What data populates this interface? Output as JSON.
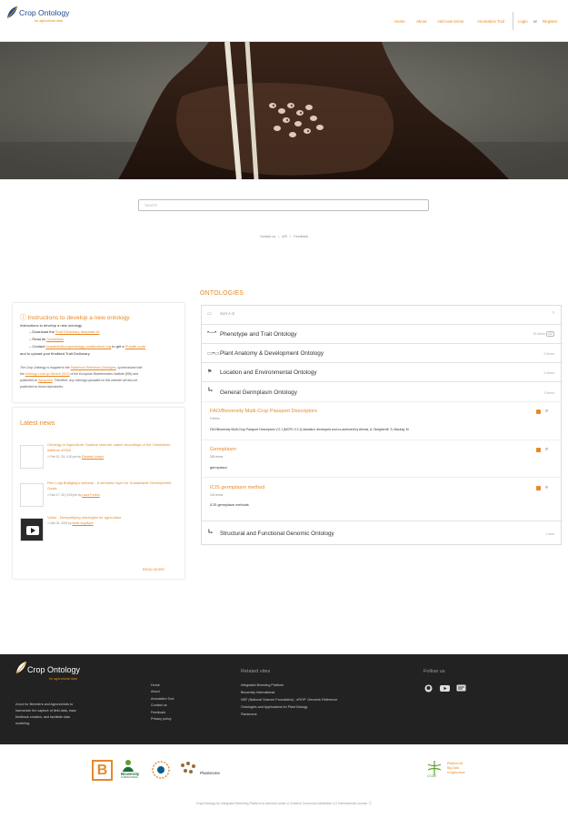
{
  "header": {
    "logo_title": "Crop Ontology",
    "logo_tagline": "for agricultural data",
    "nav": [
      "Home",
      "About",
      "Add new terms",
      "Annotation Tool"
    ],
    "login": "Login",
    "or": "or",
    "register": "Register"
  },
  "search": {
    "placeholder": "Search"
  },
  "links": {
    "contact": "Contact us",
    "sep": "•",
    "api": "API",
    "feedback": "Feedback"
  },
  "instructions": {
    "title": "Instructions to develop a new ontology",
    "intro": "Instructions to develop a new ontology",
    "step1_prefix": "Download the",
    "step1_link": "Trait Dictionary template v5",
    "step2_prefix": "Read its",
    "step2_link": "Guidelines",
    "step3_prefix": "Contact",
    "step3_email": "helpdesk@cropontology-curationtool.org",
    "step3_mid": "to get a",
    "step3_link": "Private code",
    "step3_suffix": "and to upload your finalised Trait Dictionary",
    "note1": "The Crop Ontology is mapped to the",
    "note1_link": "Planteome Reference Ontologies",
    "note1_suffix": ", synchronized with",
    "note2": "the",
    "note2_link": "Ontology Look-up Service (OLS)",
    "note2_suffix": "of the European Bioinformatics Institute (EBI) and",
    "note3": "published on",
    "note3_link": "Agroportal",
    "note3_suffix": ". Therefore, any ontology uploaded on this website will also be",
    "note4": "published on those repositories."
  },
  "news": {
    "title": "Latest news",
    "items": [
      {
        "title": "Ontology in Agriculture Youtube channel: watch recordings of the Ontoinfarm webinar #2020",
        "date": "Feb 10, 20 | 4:00 pm",
        "by": "by",
        "author": "Elizabeth Arnaud"
      },
      {
        "title": "Pier Luigi Buttigieg's webinar - A semantic layer for Sustainable Development Goals",
        "date": "Dec 17, 20 | 4:00 pm",
        "by": "by",
        "author": "Laura Forcina"
      },
      {
        "title": "Video - Demystifying ontologies for agriculture",
        "date": "Mar 23, 2019",
        "by": "by",
        "author": "Marie-Angélique"
      }
    ],
    "read_more": "READ MORE"
  },
  "ontologies": {
    "title": "ONTOLOGIES",
    "sort_label": "Sort A-Z",
    "categories": [
      {
        "icon": "•—•",
        "title": "Phenotype and Trait Ontology",
        "count": "35 items",
        "page": "1/2"
      },
      {
        "icon": "▭•▭",
        "title": "Plant Anatomy & Development Ontology",
        "count": "2 items"
      },
      {
        "icon": "⚑",
        "title": "Location and Environmental Ontology",
        "count": "2 items"
      },
      {
        "icon": "┗▪",
        "title": "General Germplasm Ontology",
        "count": "3 items"
      },
      {
        "icon": "┗▪",
        "title": "Structural and Functional Genomic Ontology",
        "count": "1 item"
      }
    ],
    "germplasm_items": [
      {
        "title": "FAO/Bioversity Multi-Crop Passport Descriptors",
        "terms": "0 terms",
        "desc": "FAO/Bioversity Multi-Crop Passport Descriptors V.2.1 [MCPD V.2.1] standard, developed and co-authored by Alercia, A; Diulgheroff, S; Mackay, M"
      },
      {
        "title": "Germplasm",
        "terms": "339 terms",
        "desc": "germplasm"
      },
      {
        "title": "ICIS germplasm method",
        "terms": "104 terms",
        "desc": "ICIS germplasm methods"
      }
    ]
  },
  "footer": {
    "logo_title": "Crop Ontology",
    "logo_tagline": "for agricultural data",
    "about_text": [
      "A tool for Breeders and Agronomists to",
      "harmonize the capture of field data, ease",
      "fieldbook creation, and facilitate data",
      "modeling."
    ],
    "nav": [
      "Home",
      "About",
      "Annotation Tool",
      "Contact us",
      "Feedback",
      "Privacy policy"
    ],
    "related_title": "Related sites",
    "related": [
      "Integrated Breeding Platform",
      "Bioversity International",
      "NSF (National Science Foundation) - eROP: Genomic Reference",
      "Ontologies and Applications for Plant Biology",
      "Planteome"
    ],
    "follow_title": "Follow us"
  },
  "partners": {
    "p1": "B",
    "p2": "Bioversity",
    "p2_sub": "INTERNATIONAL",
    "p3": "Planteome",
    "cgiar": "CGIAR",
    "cgiar_text": [
      "Platform for",
      "Big Data",
      "in Agriculture"
    ]
  },
  "license": "CropOntology by Integrated Breeding Platform is licensed under a Creative Commons Attribution 4.0 International License",
  "colors": {
    "accent": "#e6892a",
    "brand": "#1c4c8c",
    "footer_bg": "#222222"
  }
}
